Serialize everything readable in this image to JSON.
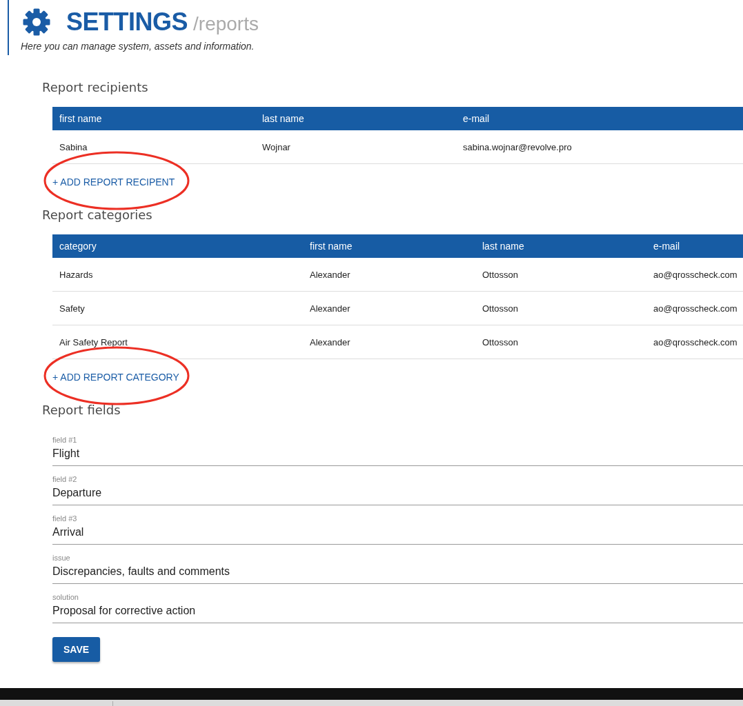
{
  "header": {
    "title": "SETTINGS",
    "path": "/reports",
    "description": "Here you can manage system, assets and information."
  },
  "sections": [
    {
      "kind": "table",
      "title": "Report recipients",
      "table": {
        "columns": [
          "first name",
          "last name",
          "e-mail"
        ],
        "rows": [
          [
            "Sabina",
            "Wojnar",
            "sabina.wojnar@revolve.pro"
          ]
        ]
      },
      "add_link": {
        "label": "+ ADD REPORT RECIPENT",
        "highlighted": true
      }
    },
    {
      "kind": "table",
      "title": "Report categories",
      "table": {
        "columns": [
          "category",
          "first name",
          "last name",
          "e-mail"
        ],
        "rows": [
          [
            "Hazards",
            "Alexander",
            "Ottosson",
            "ao@qrosscheck.com"
          ],
          [
            "Safety",
            "Alexander",
            "Ottosson",
            "ao@qrosscheck.com"
          ],
          [
            "Air Safety Report",
            "Alexander",
            "Ottosson",
            "ao@qrosscheck.com"
          ]
        ]
      },
      "add_link": {
        "label": "+ ADD REPORT CATEGORY",
        "highlighted": true
      }
    },
    {
      "kind": "fields",
      "title": "Report fields",
      "fields": [
        {
          "label": "field #1",
          "value": "Flight"
        },
        {
          "label": "field #2",
          "value": "Departure"
        },
        {
          "label": "field #3",
          "value": "Arrival"
        },
        {
          "label": "issue",
          "value": "Discrepancies, faults and comments"
        },
        {
          "label": "solution",
          "value": "Proposal for corrective action"
        }
      ],
      "button": "SAVE"
    }
  ]
}
